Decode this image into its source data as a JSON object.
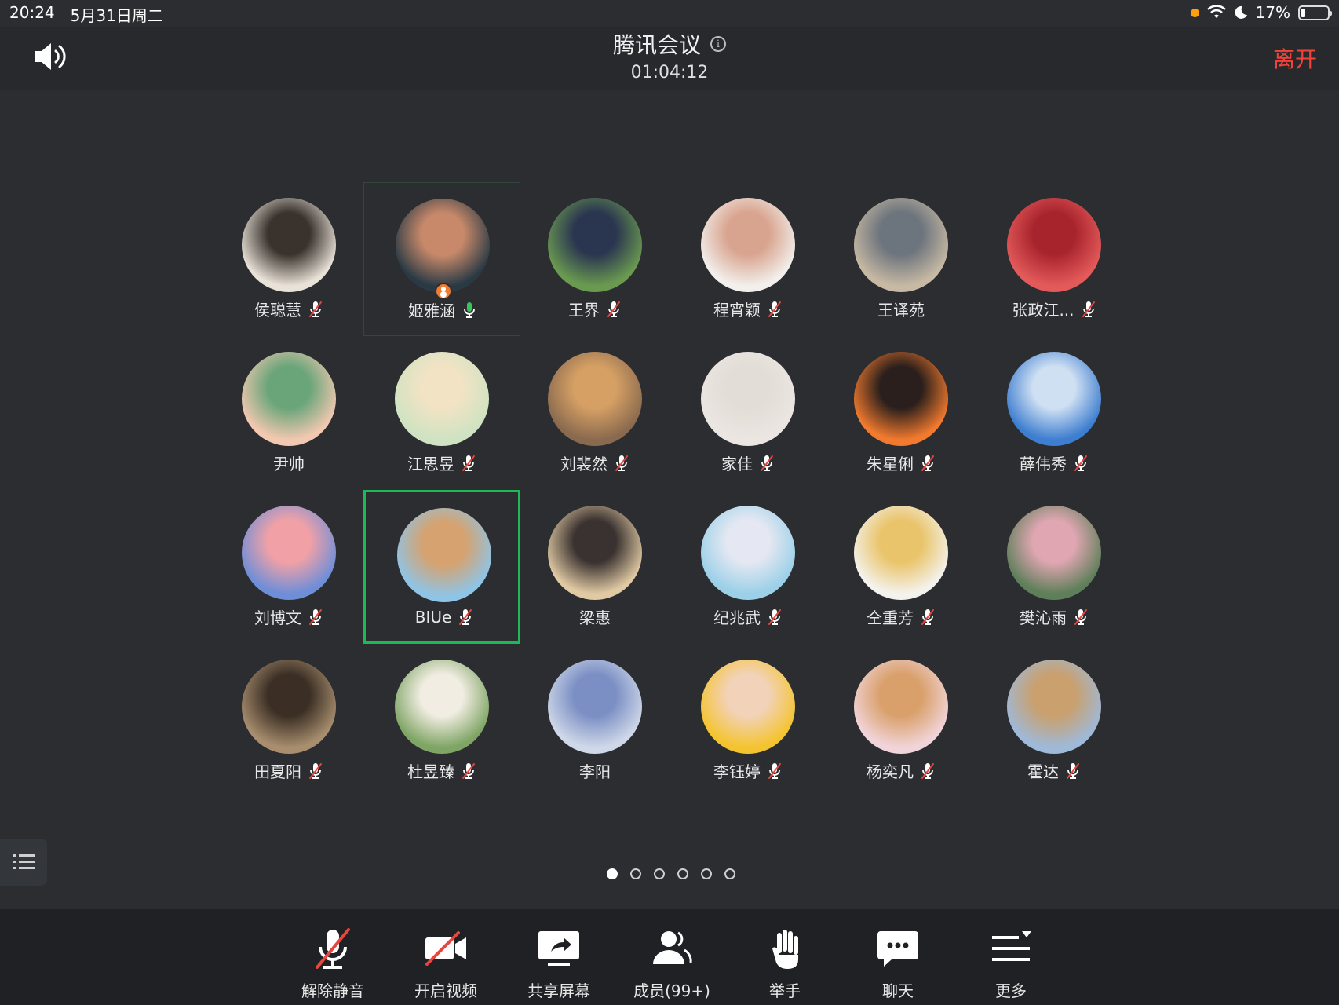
{
  "status_bar": {
    "time": "20:24",
    "date": "5月31日周二",
    "battery": "17%"
  },
  "header": {
    "title": "腾讯会议",
    "timer": "01:04:12",
    "leave": "离开"
  },
  "participants": [
    {
      "name": "侯聪慧",
      "mic": "muted",
      "colors": [
        "#e9e2d8",
        "#3a332d"
      ]
    },
    {
      "name": "姬雅涵",
      "mic": "on",
      "host": true,
      "speaking": true,
      "colors": [
        "#2a3a45",
        "#c8896a"
      ]
    },
    {
      "name": "王界",
      "mic": "muted",
      "colors": [
        "#6a9a50",
        "#2a3550"
      ]
    },
    {
      "name": "程宵颖",
      "mic": "muted",
      "colors": [
        "#f2efec",
        "#d9a48f"
      ]
    },
    {
      "name": "王译苑",
      "mic": "none",
      "colors": [
        "#c7b9a3",
        "#6c747d"
      ]
    },
    {
      "name": "张政江...",
      "mic": "muted",
      "colors": [
        "#e35a5a",
        "#a8242d"
      ]
    },
    {
      "name": "尹帅",
      "mic": "none",
      "colors": [
        "#f2c8b0",
        "#6aa57a"
      ]
    },
    {
      "name": "江思昱",
      "mic": "muted",
      "colors": [
        "#cfe3c2",
        "#f1e3c4"
      ]
    },
    {
      "name": "刘裴然",
      "mic": "muted",
      "colors": [
        "#8a6a4f",
        "#d6a064"
      ]
    },
    {
      "name": "家佳",
      "mic": "muted",
      "colors": [
        "#ebe6e2",
        "#e3ddd7"
      ]
    },
    {
      "name": "朱星俐",
      "mic": "muted",
      "colors": [
        "#f27a2e",
        "#2a1f1c"
      ]
    },
    {
      "name": "薛伟秀",
      "mic": "muted",
      "colors": [
        "#3e7ed0",
        "#cfe0f2"
      ]
    },
    {
      "name": "刘博文",
      "mic": "muted",
      "colors": [
        "#6f8ed8",
        "#f1a1a6"
      ]
    },
    {
      "name": "BIUe",
      "mic": "muted",
      "active": true,
      "colors": [
        "#8fc4e6",
        "#d6a26f"
      ]
    },
    {
      "name": "梁惠",
      "mic": "none",
      "colors": [
        "#e0c9a3",
        "#3a3230"
      ]
    },
    {
      "name": "纪兆武",
      "mic": "muted",
      "colors": [
        "#9bd0e8",
        "#e5e8f2"
      ]
    },
    {
      "name": "仝重芳",
      "mic": "muted",
      "colors": [
        "#f4f2ec",
        "#e9c46a"
      ]
    },
    {
      "name": "樊沁雨",
      "mic": "muted",
      "colors": [
        "#5f7f5a",
        "#e0a6b2"
      ]
    },
    {
      "name": "田夏阳",
      "mic": "muted",
      "colors": [
        "#a88e6e",
        "#3b2f25"
      ]
    },
    {
      "name": "杜昱臻",
      "mic": "muted",
      "colors": [
        "#7fa565",
        "#f1ede2"
      ]
    },
    {
      "name": "李阳",
      "mic": "none",
      "colors": [
        "#cfd8e8",
        "#7b8fc4"
      ]
    },
    {
      "name": "李钰婷",
      "mic": "muted",
      "colors": [
        "#f4c430",
        "#f2d2b8"
      ]
    },
    {
      "name": "杨奕凡",
      "mic": "muted",
      "colors": [
        "#f1d4d9",
        "#d9a06b"
      ]
    },
    {
      "name": "霍达",
      "mic": "muted",
      "colors": [
        "#9fb9d9",
        "#c9a06e"
      ]
    }
  ],
  "page_dots": {
    "total": 6,
    "current": 1
  },
  "toolbar": {
    "unmute": "解除静音",
    "video": "开启视频",
    "share": "共享屏幕",
    "members": "成员(99+)",
    "raise_hand": "举手",
    "chat": "聊天",
    "more": "更多"
  },
  "icons": {
    "speaker": "speaker-icon",
    "info": "info-icon",
    "mic_muted": "mic-muted-icon",
    "mic_on": "mic-on-icon",
    "list": "list-icon"
  }
}
